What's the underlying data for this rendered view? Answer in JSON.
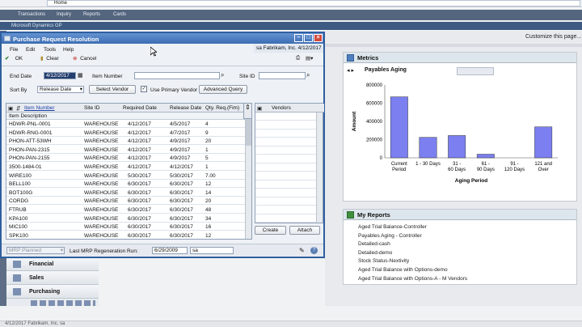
{
  "browser": {
    "address": "Home"
  },
  "nav": {
    "items": [
      "Transactions",
      "Inquiry",
      "Reports",
      "Cards"
    ]
  },
  "app": {
    "title": "Microsoft Dynamics GP",
    "customize": "Customize this page..."
  },
  "window": {
    "title": "Purchase Request Resolution",
    "menu": [
      "File",
      "Edit",
      "Tools",
      "Help"
    ],
    "company": "sa   Fabrikam, Inc.   4/12/2017",
    "toolbar": {
      "ok": "OK",
      "clear": "Clear",
      "cancel": "Cancel"
    },
    "end_date_label": "End Date",
    "end_date_value": "4/12/2017",
    "item_number_label": "Item Number",
    "site_id_label": "Site ID",
    "sort_by_label": "Sort By",
    "sort_by_value": "Release Date",
    "select_vendor": "Select Vendor",
    "use_primary_vendor": "Use Primary Vendor",
    "advanced_query": "Advanced Query",
    "grid": {
      "headers": [
        "Item Number",
        "Site ID",
        "Required Date",
        "Release Date",
        "Qty. Req.(Fim)"
      ],
      "sub_header": "Item Description",
      "rows": [
        [
          "HDWR-PNL-0001",
          "WAREHOUSE",
          "4/12/2017",
          "4/5/2017",
          "4"
        ],
        [
          "HDWR-RNG-0001",
          "WAREHOUSE",
          "4/12/2017",
          "4/7/2017",
          "9"
        ],
        [
          "PHON-ATT-53WH",
          "WAREHOUSE",
          "4/12/2017",
          "4/9/2017",
          "20"
        ],
        [
          "PHON-PAN-2315",
          "WAREHOUSE",
          "4/12/2017",
          "4/9/2017",
          "1"
        ],
        [
          "PHON-PAN-2155",
          "WAREHOUSE",
          "4/12/2017",
          "4/9/2017",
          "5"
        ],
        [
          "3500-1484-01",
          "WAREHOUSE",
          "4/12/2017",
          "4/12/2017",
          "1"
        ],
        [
          "WIRE100",
          "WAREHOUSE",
          "5/30/2017",
          "5/30/2017",
          "7.00"
        ],
        [
          "BELL100",
          "WAREHOUSE",
          "6/30/2017",
          "6/30/2017",
          "12"
        ],
        [
          "BOT100G",
          "WAREHOUSE",
          "6/30/2017",
          "6/30/2017",
          "14"
        ],
        [
          "CORDG",
          "WAREHOUSE",
          "6/30/2017",
          "6/30/2017",
          "20"
        ],
        [
          "FTRUB",
          "WAREHOUSE",
          "6/30/2017",
          "6/30/2017",
          "48"
        ],
        [
          "KPA100",
          "WAREHOUSE",
          "6/30/2017",
          "6/30/2017",
          "34"
        ],
        [
          "MIC100",
          "WAREHOUSE",
          "6/30/2017",
          "6/30/2017",
          "16"
        ],
        [
          "SPK100",
          "WAREHOUSE",
          "6/30/2017",
          "6/30/2017",
          "12"
        ]
      ]
    },
    "vendors_header": "Vendors",
    "create": "Create",
    "attach": "Attach",
    "mrp_planned": "MRP Planned",
    "last_mrp_label": "Last MRP Regeneration Run:",
    "last_mrp_date": "6/29/2009",
    "last_mrp_user": "sa"
  },
  "metrics": {
    "title": "Metrics",
    "subtitle": "Payables Aging",
    "chart_data": {
      "type": "bar",
      "categories": [
        "Current Period",
        "1 - 30 Days",
        "31 - 60 Days",
        "61 - 90 Days",
        "91 - 120 Days",
        "121 and Over"
      ],
      "values": [
        670000,
        225000,
        245000,
        40000,
        0,
        340000
      ],
      "xlabel": "Aging Period",
      "ylabel": "Amount",
      "ylim": [
        0,
        800000
      ],
      "yticks": [
        "0",
        "200000",
        "400000",
        "600000",
        "800000"
      ],
      "bar_color": "#7b7ff0"
    }
  },
  "sidebar": {
    "items": [
      "Financial",
      "Sales",
      "Purchasing"
    ]
  },
  "my_reports": {
    "title": "My Reports",
    "items": [
      "Aged Trial Balance-Controller",
      "Payables Aging - Controller",
      "Detailed-cash",
      "Detailed-demo",
      "Stock Status-Nextivity",
      "Aged Trial Balance with Options-demo",
      "Aged Trial Balance with Options-A - M Vendors"
    ]
  },
  "status": {
    "text": "4/12/2017   Fabrikam, Inc.   sa"
  }
}
